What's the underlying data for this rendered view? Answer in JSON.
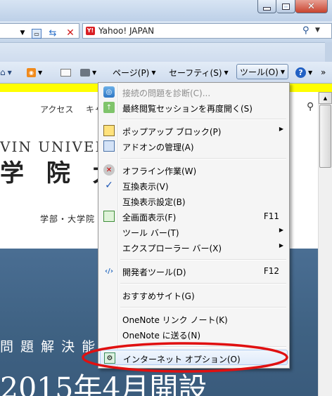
{
  "search": {
    "provider": "Yahoo! JAPAN"
  },
  "commandbar": {
    "page": "ページ(P)",
    "safety": "セーフティ(S)",
    "tools": "ツール(O)",
    "more": "»"
  },
  "page": {
    "nav_access": "アクセス",
    "nav_career": "キャ",
    "univ_en": "VIN UNIVERS",
    "univ_jp": "学 院 大",
    "nav_faculty": "学部・大学院",
    "hero_sub": "問 題 解 決 能",
    "hero_title": "2015年4月開設"
  },
  "menu": {
    "items": [
      {
        "label": "接続の問題を診断(C)...",
        "shortcut": "",
        "icon": "globe-diagnose-icon",
        "disabled": true
      },
      {
        "label": "最終閲覧セッションを再度開く(S)",
        "shortcut": "",
        "icon": "reopen-session-icon"
      },
      {
        "label": "ポップアップ ブロック(P)",
        "shortcut": "",
        "icon": "popup-blocker-icon",
        "submenu": true
      },
      {
        "label": "アドオンの管理(A)",
        "shortcut": "",
        "icon": "addons-icon"
      },
      {
        "label": "オフライン作業(W)",
        "shortcut": "",
        "icon": "offline-icon"
      },
      {
        "label": "互換表示(V)",
        "shortcut": "",
        "icon": "checkmark-icon",
        "checked": true
      },
      {
        "label": "互換表示設定(B)",
        "shortcut": ""
      },
      {
        "label": "全画面表示(F)",
        "shortcut": "F11",
        "icon": "fullscreen-icon"
      },
      {
        "label": "ツール バー(T)",
        "shortcut": "",
        "submenu": true
      },
      {
        "label": "エクスプローラー バー(X)",
        "shortcut": "",
        "submenu": true
      },
      {
        "label": "開発者ツール(D)",
        "shortcut": "F12",
        "icon": "developer-tools-icon"
      },
      {
        "label": "おすすめサイト(G)",
        "shortcut": ""
      },
      {
        "label": "OneNote リンク ノート(K)",
        "shortcut": ""
      },
      {
        "label": "OneNote に送る(N)",
        "shortcut": ""
      },
      {
        "label": "インターネット オプション(O)",
        "shortcut": "",
        "icon": "internet-options-icon",
        "highlighted": true
      }
    ]
  },
  "colors": {
    "highlight_ellipse": "#e01010",
    "yellow_bar": "#ffff00",
    "hero_bg": "#44678b"
  }
}
